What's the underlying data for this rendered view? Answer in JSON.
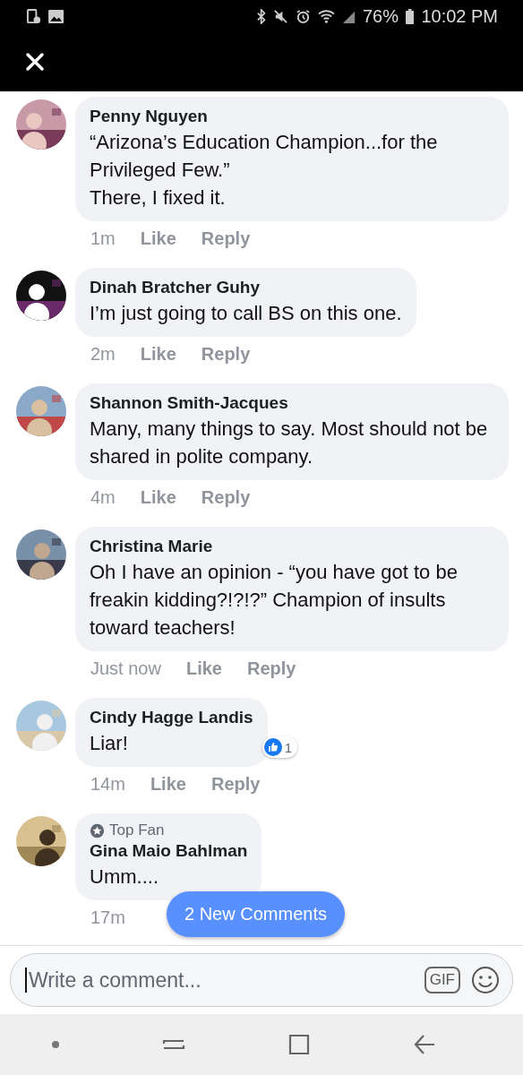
{
  "status_bar": {
    "battery": "76%",
    "time": "10:02 PM"
  },
  "comments": [
    {
      "name": "Penny Nguyen",
      "text": "“Arizona’s Education Champion...for the Privileged Few.”\nThere, I fixed it.",
      "time": "1m",
      "actions": [
        "Like",
        "Reply"
      ]
    },
    {
      "name": "Dinah Bratcher Guhy",
      "text": "I’m just going to call BS on this one.",
      "time": "2m",
      "actions": [
        "Like",
        "Reply"
      ]
    },
    {
      "name": "Shannon Smith-Jacques",
      "text": "Many, many things to say. Most should not be shared in polite company.",
      "time": "4m",
      "actions": [
        "Like",
        "Reply"
      ]
    },
    {
      "name": "Christina Marie",
      "text": "Oh I have an opinion - “you have got to be freakin kidding?!?!?” Champion of insults toward teachers!",
      "time": "Just now",
      "actions": [
        "Like",
        "Reply"
      ]
    },
    {
      "name": "Cindy Hagge Landis",
      "text": "Liar!",
      "time": "14m",
      "actions": [
        "Like",
        "Reply"
      ],
      "reactions": "1"
    },
    {
      "name": "Gina Maio Bahlman",
      "badge": "Top Fan",
      "text": "Umm....",
      "time": "17m"
    }
  ],
  "new_comments_button": "2 New Comments",
  "composer": {
    "placeholder": "Write a comment...",
    "gif": "GIF"
  }
}
